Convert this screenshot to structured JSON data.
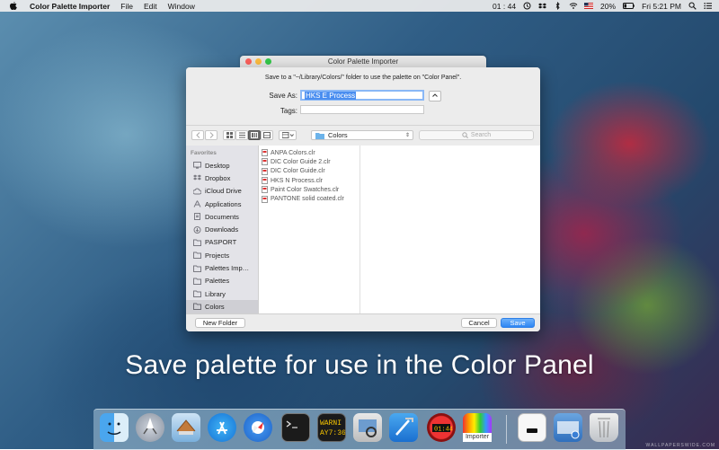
{
  "menubar": {
    "app_name": "Color Palette Importer",
    "menus": [
      "File",
      "Edit",
      "Window"
    ],
    "time_display": "01 : 44",
    "battery": "20%",
    "clock": "Fri 5:21 PM"
  },
  "window": {
    "title": "Color Palette Importer",
    "prompt": "Save to a \"~/Library/Colors/\" folder to use the palette on \"Color Panel\".",
    "save_as_label": "Save As:",
    "save_as_value": "HKS E Process",
    "tags_label": "Tags:",
    "tags_value": "",
    "location": "Colors",
    "search_placeholder": "Search",
    "sidebar": {
      "heading": "Favorites",
      "items": [
        {
          "label": "Desktop",
          "icon": "desktop-icon"
        },
        {
          "label": "Dropbox",
          "icon": "dropbox-icon"
        },
        {
          "label": "iCloud Drive",
          "icon": "cloud-icon"
        },
        {
          "label": "Applications",
          "icon": "applications-icon"
        },
        {
          "label": "Documents",
          "icon": "documents-icon"
        },
        {
          "label": "Downloads",
          "icon": "downloads-icon"
        },
        {
          "label": "PASPORT",
          "icon": "folder-icon"
        },
        {
          "label": "Projects",
          "icon": "folder-icon"
        },
        {
          "label": "Palettes Imp…",
          "icon": "folder-icon"
        },
        {
          "label": "Palettes",
          "icon": "folder-icon"
        },
        {
          "label": "Library",
          "icon": "folder-icon"
        },
        {
          "label": "Colors",
          "icon": "folder-icon",
          "selected": true
        }
      ]
    },
    "files": [
      "ANPA Colors.clr",
      "DIC Color Guide 2.clr",
      "DIC Color Guide.clr",
      "HKS N Process.clr",
      "Paint Color Swatches.clr",
      "PANTONE solid coated.clr"
    ],
    "new_folder_label": "New Folder",
    "cancel_label": "Cancel",
    "save_label": "Save"
  },
  "caption": "Save palette for use in the Color Panel",
  "dock": {
    "items": [
      "finder-icon",
      "launchpad-icon",
      "mail-icon",
      "app-store-icon",
      "safari-icon",
      "terminal-icon",
      "console-icon",
      "preview-icon",
      "xcode-icon",
      "timer-icon",
      "importer-icon",
      "document-icon",
      "screenshot-icon",
      "trash-icon"
    ],
    "importer_label": "Importer"
  },
  "colors": {
    "accent": "#2f86f3",
    "selection": "#4a8ef0"
  }
}
